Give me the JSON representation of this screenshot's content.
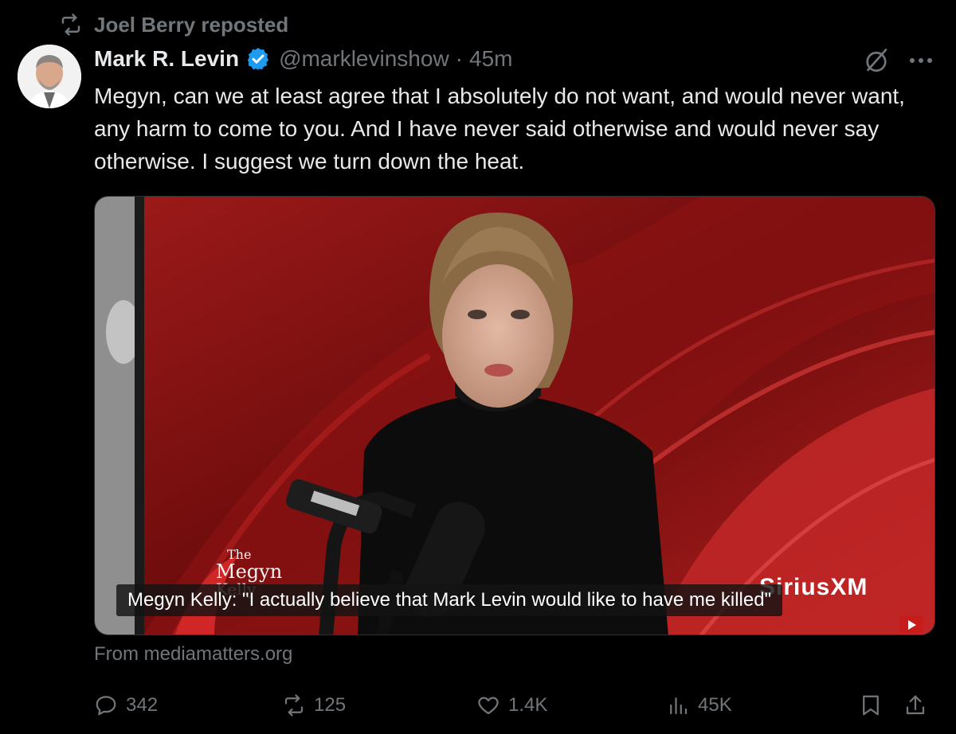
{
  "repost": {
    "text": "Joel Berry reposted",
    "icon": "repost-icon"
  },
  "author": {
    "name": "Mark R. Levin",
    "handle": "@marklevinshow",
    "separator": "·",
    "time": "45m",
    "verified_color": "#1d9bf0"
  },
  "tweet": {
    "text": "Megyn, can we at least agree that I absolutely do not want, and would never want, any harm to come to you.  And I have never said otherwise and would never say otherwise.  I suggest we turn down the heat."
  },
  "media": {
    "caption": "Megyn Kelly: \"I actually believe that Mark Levin would like to have me killed\"",
    "logo_the": "The",
    "logo_megyn": "Megyn",
    "logo_kelly": "Kelly",
    "watermark": "SiriusXM",
    "source": "From mediamatters.org"
  },
  "actions": {
    "replies": "342",
    "reposts": "125",
    "likes": "1.4K",
    "views": "45K"
  },
  "colors": {
    "background": "#000000",
    "text": "#e7e9ea",
    "muted": "#71767b",
    "accent": "#1d9bf0"
  }
}
